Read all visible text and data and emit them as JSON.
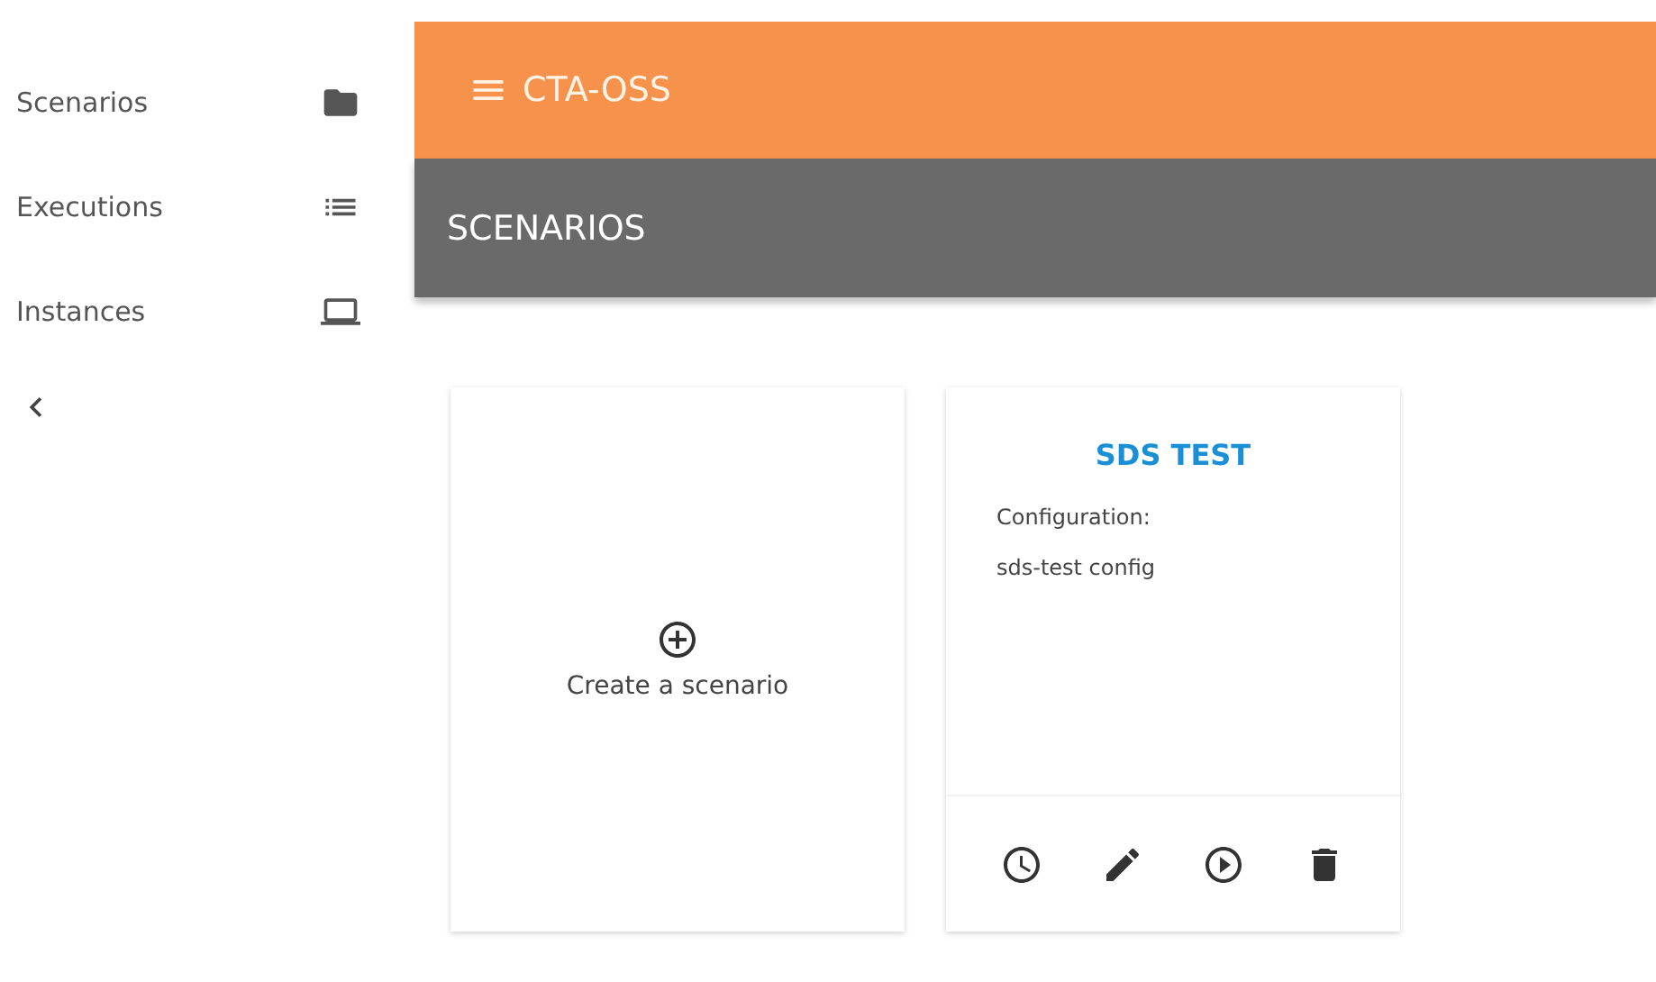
{
  "sidebar": {
    "items": [
      {
        "label": "Scenarios"
      },
      {
        "label": "Executions"
      },
      {
        "label": "Instances"
      }
    ]
  },
  "app_bar": {
    "title": "CTA-OSS"
  },
  "page_header": {
    "title": "SCENARIOS"
  },
  "create_card": {
    "label": "Create a scenario"
  },
  "scenarios": [
    {
      "name": "SDS TEST",
      "config_label": "Configuration:",
      "config": "sds-test config"
    }
  ]
}
